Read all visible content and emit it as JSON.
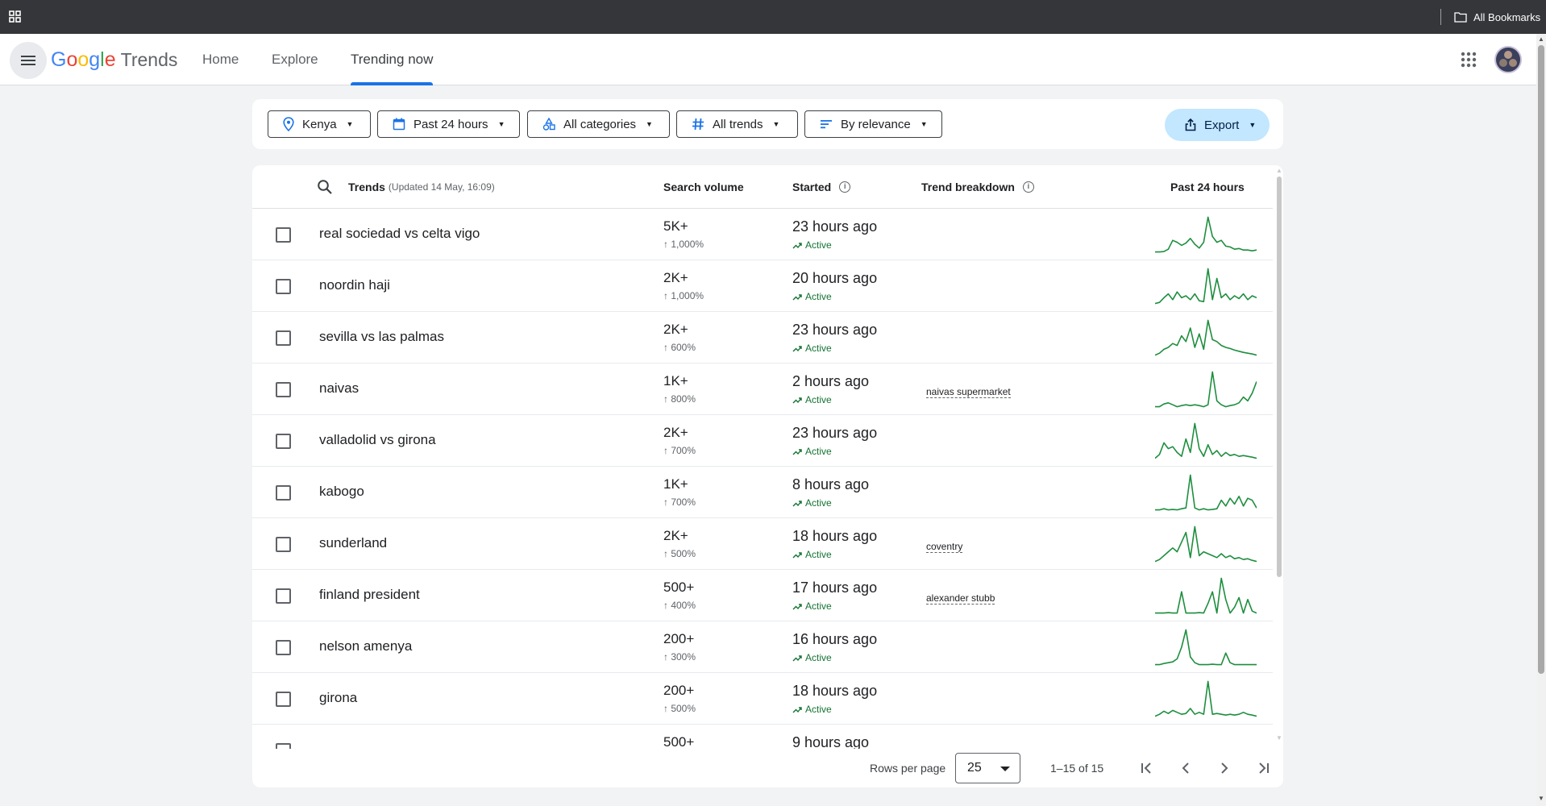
{
  "bookmarks_bar": {
    "all_bookmarks_label": "All Bookmarks"
  },
  "header": {
    "logo_google": "Google",
    "logo_trends": "Trends",
    "nav": [
      {
        "label": "Home",
        "active": false
      },
      {
        "label": "Explore",
        "active": false
      },
      {
        "label": "Trending now",
        "active": true
      }
    ]
  },
  "filters": {
    "location": "Kenya",
    "time": "Past 24 hours",
    "category": "All categories",
    "trend_type": "All trends",
    "sort": "By relevance",
    "export_label": "Export"
  },
  "table": {
    "headers": {
      "trends": "Trends",
      "updated": "(Updated 14 May, 16:09)",
      "search_volume": "Search volume",
      "started": "Started",
      "trend_breakdown": "Trend breakdown",
      "past_24_hours": "Past 24 hours"
    },
    "rows": [
      {
        "name": "real sociedad vs celta vigo",
        "volume": "5K+",
        "increase": "↑ 1,000%",
        "started": "23 hours ago",
        "status": "Active",
        "breakdown": "",
        "spark": [
          0.05,
          0.05,
          0.06,
          0.12,
          0.35,
          0.3,
          0.22,
          0.28,
          0.4,
          0.25,
          0.15,
          0.3,
          0.95,
          0.45,
          0.3,
          0.35,
          0.2,
          0.18,
          0.12,
          0.14,
          0.1,
          0.1,
          0.08,
          0.1
        ]
      },
      {
        "name": "noordin haji",
        "volume": "2K+",
        "increase": "↑ 1,000%",
        "started": "20 hours ago",
        "status": "Active",
        "breakdown": "",
        "spark": [
          0.05,
          0.08,
          0.2,
          0.3,
          0.15,
          0.35,
          0.2,
          0.25,
          0.15,
          0.3,
          0.12,
          0.1,
          0.95,
          0.15,
          0.7,
          0.2,
          0.3,
          0.15,
          0.25,
          0.18,
          0.3,
          0.15,
          0.25,
          0.2
        ]
      },
      {
        "name": "sevilla vs las palmas",
        "volume": "2K+",
        "increase": "↑ 600%",
        "started": "23 hours ago",
        "status": "Active",
        "breakdown": "",
        "spark": [
          0.05,
          0.1,
          0.2,
          0.25,
          0.35,
          0.3,
          0.55,
          0.4,
          0.75,
          0.25,
          0.6,
          0.2,
          0.95,
          0.45,
          0.4,
          0.3,
          0.25,
          0.22,
          0.18,
          0.15,
          0.12,
          0.1,
          0.08,
          0.05
        ]
      },
      {
        "name": "naivas",
        "volume": "1K+",
        "increase": "↑ 800%",
        "started": "2 hours ago",
        "status": "Active",
        "breakdown": "naivas supermarket",
        "spark": [
          0.05,
          0.05,
          0.12,
          0.15,
          0.1,
          0.05,
          0.08,
          0.1,
          0.08,
          0.1,
          0.08,
          0.05,
          0.1,
          0.95,
          0.2,
          0.1,
          0.05,
          0.08,
          0.1,
          0.15,
          0.3,
          0.2,
          0.4,
          0.7
        ]
      },
      {
        "name": "valladolid vs girona",
        "volume": "2K+",
        "increase": "↑ 700%",
        "started": "23 hours ago",
        "status": "Active",
        "breakdown": "",
        "spark": [
          0.05,
          0.15,
          0.45,
          0.3,
          0.35,
          0.2,
          0.1,
          0.55,
          0.2,
          0.95,
          0.3,
          0.1,
          0.4,
          0.15,
          0.25,
          0.1,
          0.2,
          0.12,
          0.15,
          0.1,
          0.12,
          0.1,
          0.08,
          0.05
        ]
      },
      {
        "name": "kabogo",
        "volume": "1K+",
        "increase": "↑ 700%",
        "started": "8 hours ago",
        "status": "Active",
        "breakdown": "",
        "spark": [
          0.05,
          0.05,
          0.08,
          0.05,
          0.06,
          0.05,
          0.08,
          0.1,
          0.95,
          0.1,
          0.05,
          0.08,
          0.05,
          0.06,
          0.08,
          0.3,
          0.15,
          0.35,
          0.2,
          0.4,
          0.15,
          0.35,
          0.3,
          0.1
        ]
      },
      {
        "name": "sunderland",
        "volume": "2K+",
        "increase": "↑ 500%",
        "started": "18 hours ago",
        "status": "Active",
        "breakdown": "coventry",
        "spark": [
          0.05,
          0.1,
          0.2,
          0.3,
          0.4,
          0.3,
          0.55,
          0.8,
          0.15,
          0.95,
          0.2,
          0.3,
          0.25,
          0.2,
          0.15,
          0.25,
          0.15,
          0.2,
          0.12,
          0.15,
          0.1,
          0.12,
          0.08,
          0.05
        ]
      },
      {
        "name": "finland president",
        "volume": "500+",
        "increase": "↑ 400%",
        "started": "17 hours ago",
        "status": "Active",
        "breakdown": "alexander stubb",
        "spark": [
          0.05,
          0.05,
          0.05,
          0.06,
          0.05,
          0.05,
          0.6,
          0.05,
          0.05,
          0.05,
          0.06,
          0.05,
          0.3,
          0.6,
          0.05,
          0.95,
          0.4,
          0.05,
          0.2,
          0.45,
          0.05,
          0.4,
          0.1,
          0.05
        ]
      },
      {
        "name": "nelson amenya",
        "volume": "200+",
        "increase": "↑ 300%",
        "started": "16 hours ago",
        "status": "Active",
        "breakdown": "",
        "spark": [
          0.05,
          0.05,
          0.08,
          0.1,
          0.12,
          0.2,
          0.5,
          0.95,
          0.25,
          0.1,
          0.05,
          0.05,
          0.05,
          0.06,
          0.05,
          0.05,
          0.35,
          0.1,
          0.05,
          0.05,
          0.05,
          0.05,
          0.05,
          0.05
        ]
      },
      {
        "name": "girona",
        "volume": "200+",
        "increase": "↑ 500%",
        "started": "18 hours ago",
        "status": "Active",
        "breakdown": "",
        "spark": [
          0.05,
          0.1,
          0.18,
          0.12,
          0.2,
          0.15,
          0.1,
          0.12,
          0.25,
          0.1,
          0.15,
          0.1,
          0.95,
          0.1,
          0.12,
          0.1,
          0.08,
          0.1,
          0.08,
          0.1,
          0.15,
          0.1,
          0.08,
          0.05
        ]
      },
      {
        "name": "",
        "volume": "500+",
        "increase": "",
        "started": "9 hours ago",
        "status": "",
        "breakdown": "",
        "spark": []
      }
    ]
  },
  "pagination": {
    "rows_per_page_label": "Rows per page",
    "rows_per_page_value": "25",
    "range": "1–15 of 15"
  },
  "colors": {
    "spark_line": "#1e8e3e",
    "active_text": "#137333",
    "accent": "#1a73e8",
    "export_bg": "#c2e7ff"
  }
}
